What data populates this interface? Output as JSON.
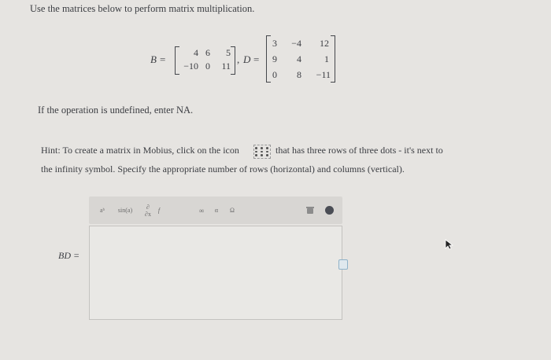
{
  "instructions": "Use the matrices below to perform matrix multiplication.",
  "matrix_b": {
    "label": "B",
    "eq": "=",
    "rows": [
      [
        "4",
        "6",
        "5"
      ],
      [
        "−10",
        "0",
        "11"
      ]
    ]
  },
  "separator": ",",
  "matrix_d": {
    "label": "D",
    "eq": "=",
    "rows": [
      [
        "3",
        "−4",
        "12"
      ],
      [
        "9",
        "4",
        "1"
      ],
      [
        "0",
        "8",
        "−11"
      ]
    ]
  },
  "note": "If the operation is undefined, enter NA.",
  "hint": {
    "line1_before": "Hint: To create a matrix in Mobius, click on the icon",
    "line1_after": "that has three rows of three dots - it's next to",
    "line2": "the infinity symbol. Specify the appropriate number of rows (horizontal) and columns (vertical)."
  },
  "toolbar": {
    "power": "aᵇ",
    "sin": "sin(a)",
    "deriv_top": "∂",
    "deriv_bottom": "∂x",
    "deriv_f": "f",
    "infinity": "∞",
    "alpha": "α",
    "omega": "Ω",
    "info": "i"
  },
  "answer": {
    "label": "BD =",
    "value": ""
  },
  "colors": {
    "page_bg": "#e6e4e1",
    "toolbar_bg": "#d8d6d3",
    "editor_bg": "#e9e8e5",
    "info_icon": "#4a4d55"
  }
}
